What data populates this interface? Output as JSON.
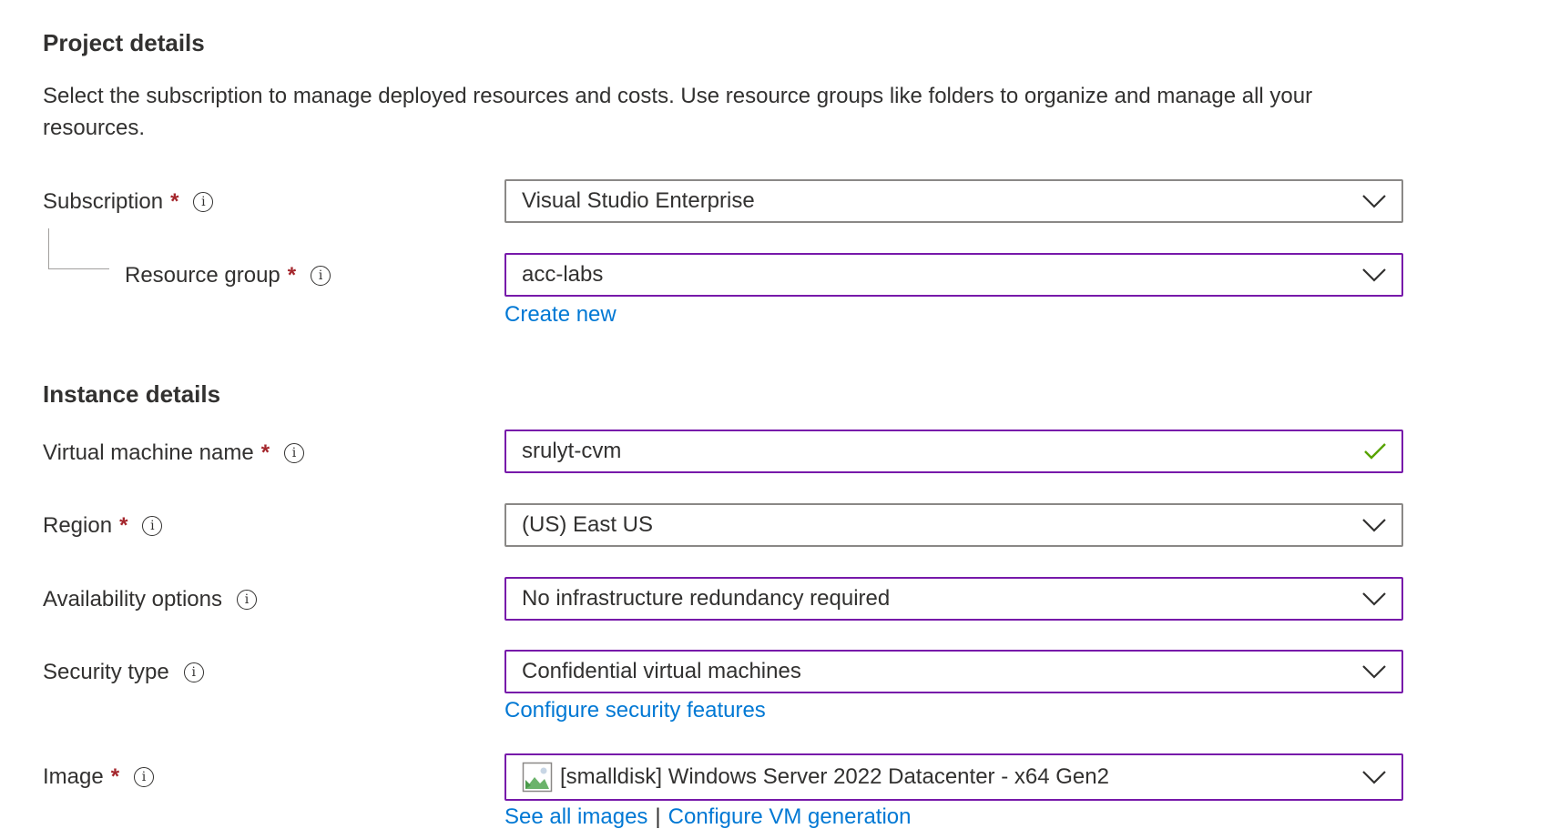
{
  "project_details": {
    "title": "Project details",
    "description": "Select the subscription to manage deployed resources and costs. Use resource groups like folders to organize and manage all your resources."
  },
  "subscription": {
    "label": "Subscription",
    "required": "*",
    "value": "Visual Studio Enterprise"
  },
  "resource_group": {
    "label": "Resource group",
    "required": "*",
    "value": "acc-labs",
    "link": "Create new"
  },
  "instance_details": {
    "title": "Instance details"
  },
  "vm_name": {
    "label": "Virtual machine name",
    "required": "*",
    "value": "srulyt-cvm"
  },
  "region": {
    "label": "Region",
    "required": "*",
    "value": "(US) East US"
  },
  "availability": {
    "label": "Availability options",
    "value": "No infrastructure redundancy required"
  },
  "security_type": {
    "label": "Security type",
    "value": "Confidential virtual machines",
    "link": "Configure security features"
  },
  "image": {
    "label": "Image",
    "required": "*",
    "value": "[smalldisk] Windows Server 2022 Datacenter - x64 Gen2",
    "link_all": "See all images",
    "separator": "|",
    "link_generation": "Configure VM generation"
  },
  "icons": {
    "info": "info-icon",
    "chevron": "chevron-down-icon",
    "check": "checkmark-icon",
    "image": "image-placeholder-icon"
  },
  "colors": {
    "required": "#a4262c",
    "link": "#0078d4",
    "focus_border": "#7719aa",
    "default_border": "#8a8886",
    "valid_check": "#57a300"
  },
  "info_glyph": "i"
}
